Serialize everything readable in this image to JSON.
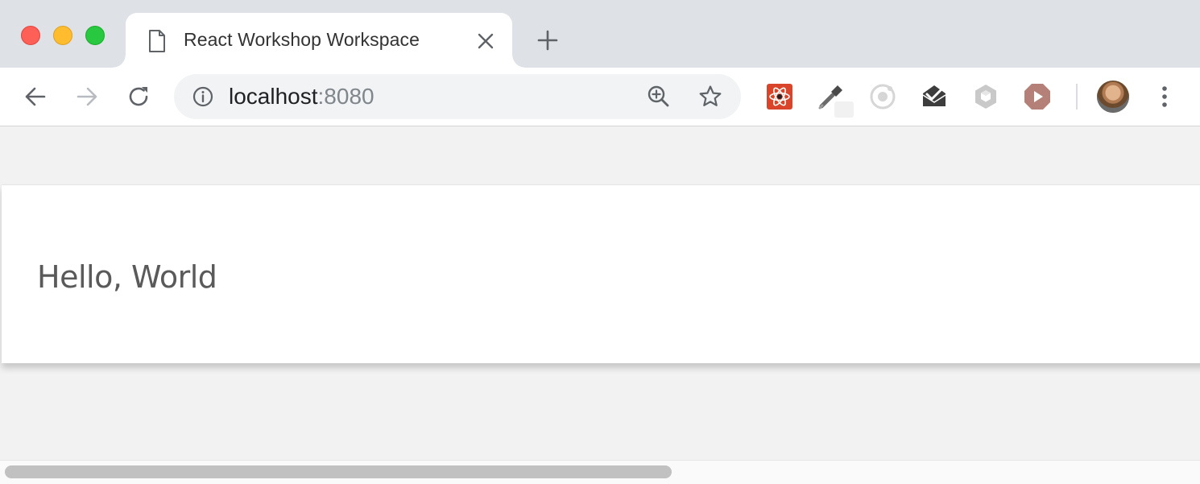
{
  "window": {
    "traffic_lights": {
      "close": "#fe5f57",
      "minimize": "#febc2e",
      "maximize": "#28c840"
    }
  },
  "tab": {
    "title": "React Workshop Workspace",
    "favicon": "document-icon"
  },
  "toolbar": {
    "url_host": "localhost",
    "url_port": ":8080",
    "icons": [
      "back-arrow-icon",
      "forward-arrow-icon",
      "reload-icon",
      "info-icon",
      "zoom-icon",
      "bookmark-star-icon"
    ],
    "extensions": [
      "react-devtools-icon",
      "color-picker-icon",
      "ionic-icon",
      "mail-check-icon",
      "cube-icon",
      "play-icon"
    ]
  },
  "page": {
    "heading": "Hello, World"
  },
  "scrollbar": {
    "horizontal_visible_fraction": 0.56
  }
}
